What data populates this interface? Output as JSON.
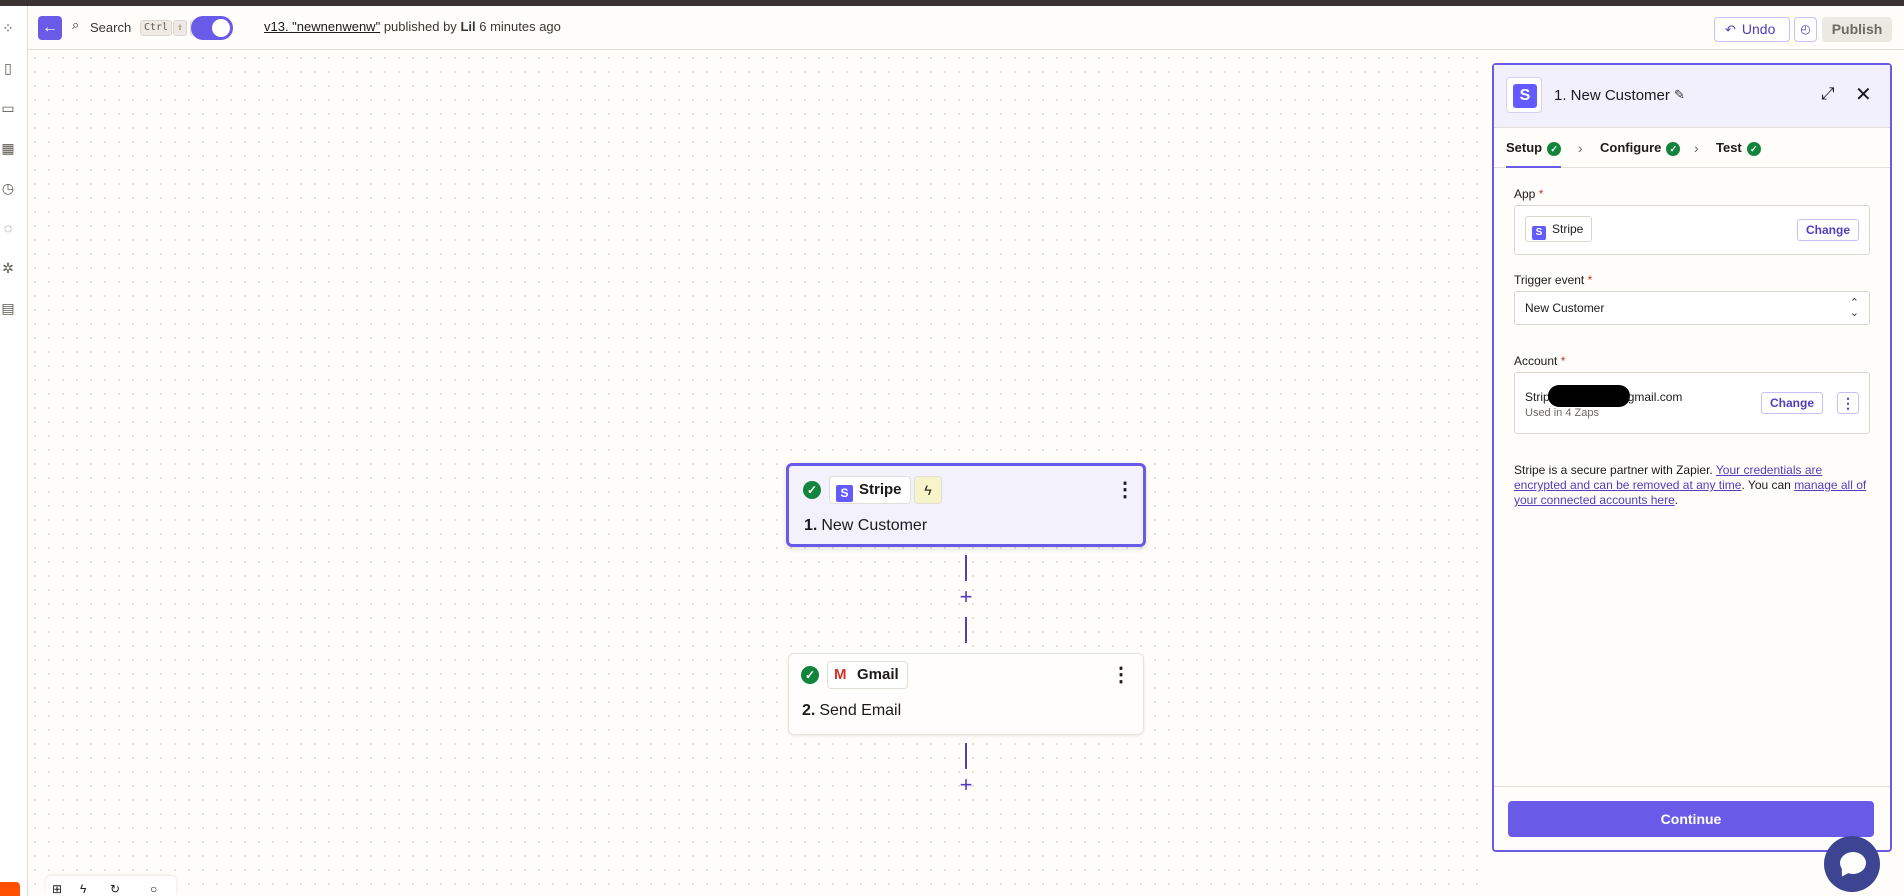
{
  "topbar": {
    "search_label": "Search",
    "shortcut_keys": [
      "Ctrl",
      "⇧",
      "F"
    ],
    "version_link": "v13. \"newnenwenw\"",
    "published_by_text": "published by",
    "author": "Lil",
    "time_ago": "6 minutes ago",
    "undo_label": "Undo",
    "publish_label": "Publish"
  },
  "steps": [
    {
      "number": "1.",
      "title": "New Customer",
      "app": "Stripe",
      "status": "complete",
      "is_trigger": true,
      "selected": true
    },
    {
      "number": "2.",
      "title": "Send Email",
      "app": "Gmail",
      "status": "complete",
      "is_trigger": false,
      "selected": false
    }
  ],
  "panel": {
    "title": "1. New Customer",
    "tabs": [
      {
        "label": "Setup",
        "complete": true
      },
      {
        "label": "Configure",
        "complete": true
      },
      {
        "label": "Test",
        "complete": true
      }
    ],
    "app_label": "App",
    "app_value": "Stripe",
    "change_label": "Change",
    "trigger_label": "Trigger event",
    "trigger_value": "New Customer",
    "account_label": "Account",
    "account_prefix": "Strip",
    "account_suffix": "gmail.com",
    "account_usage": "Used in 4 Zaps",
    "info_prefix": "Stripe is a secure partner with Zapier. ",
    "info_link1": "Your credentials are encrypted and can be removed at any time",
    "info_middle": ". You can ",
    "info_link2": "manage all of your connected accounts here",
    "info_suffix": ".",
    "continue_label": "Continue"
  },
  "colors": {
    "accent": "#695be8",
    "success": "#12843b",
    "stripe": "#635bff",
    "brand_orange": "#ff4f00"
  }
}
